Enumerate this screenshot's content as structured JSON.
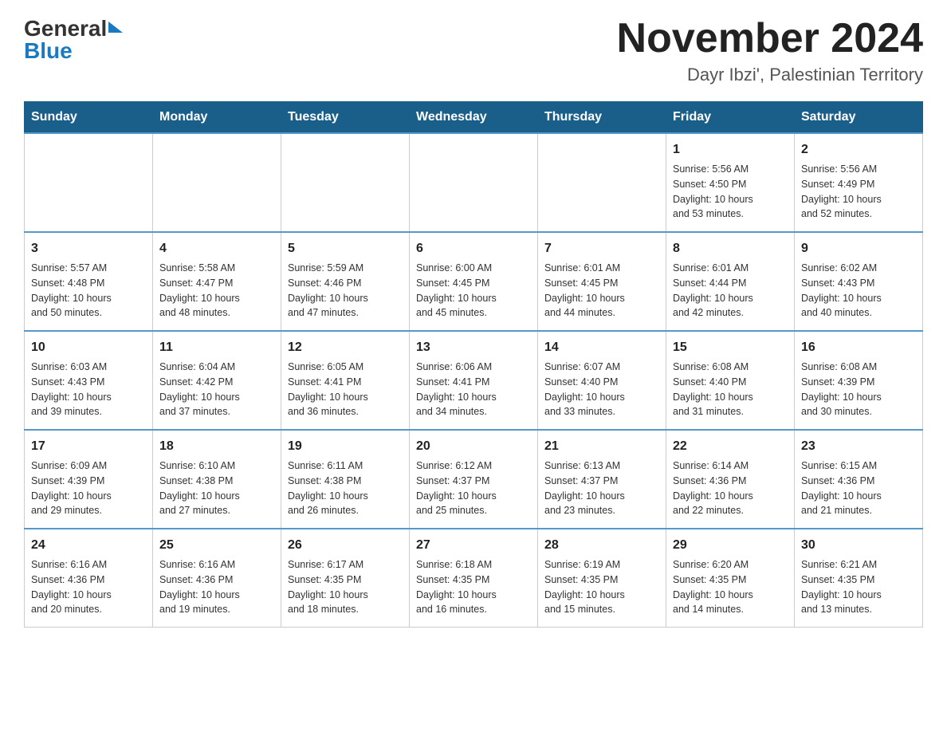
{
  "header": {
    "month_year": "November 2024",
    "location": "Dayr Ibzi', Palestinian Territory",
    "logo_part1": "General",
    "logo_part2": "Blue"
  },
  "weekdays": [
    "Sunday",
    "Monday",
    "Tuesday",
    "Wednesday",
    "Thursday",
    "Friday",
    "Saturday"
  ],
  "weeks": [
    [
      {
        "day": "",
        "info": ""
      },
      {
        "day": "",
        "info": ""
      },
      {
        "day": "",
        "info": ""
      },
      {
        "day": "",
        "info": ""
      },
      {
        "day": "",
        "info": ""
      },
      {
        "day": "1",
        "info": "Sunrise: 5:56 AM\nSunset: 4:50 PM\nDaylight: 10 hours\nand 53 minutes."
      },
      {
        "day": "2",
        "info": "Sunrise: 5:56 AM\nSunset: 4:49 PM\nDaylight: 10 hours\nand 52 minutes."
      }
    ],
    [
      {
        "day": "3",
        "info": "Sunrise: 5:57 AM\nSunset: 4:48 PM\nDaylight: 10 hours\nand 50 minutes."
      },
      {
        "day": "4",
        "info": "Sunrise: 5:58 AM\nSunset: 4:47 PM\nDaylight: 10 hours\nand 48 minutes."
      },
      {
        "day": "5",
        "info": "Sunrise: 5:59 AM\nSunset: 4:46 PM\nDaylight: 10 hours\nand 47 minutes."
      },
      {
        "day": "6",
        "info": "Sunrise: 6:00 AM\nSunset: 4:45 PM\nDaylight: 10 hours\nand 45 minutes."
      },
      {
        "day": "7",
        "info": "Sunrise: 6:01 AM\nSunset: 4:45 PM\nDaylight: 10 hours\nand 44 minutes."
      },
      {
        "day": "8",
        "info": "Sunrise: 6:01 AM\nSunset: 4:44 PM\nDaylight: 10 hours\nand 42 minutes."
      },
      {
        "day": "9",
        "info": "Sunrise: 6:02 AM\nSunset: 4:43 PM\nDaylight: 10 hours\nand 40 minutes."
      }
    ],
    [
      {
        "day": "10",
        "info": "Sunrise: 6:03 AM\nSunset: 4:43 PM\nDaylight: 10 hours\nand 39 minutes."
      },
      {
        "day": "11",
        "info": "Sunrise: 6:04 AM\nSunset: 4:42 PM\nDaylight: 10 hours\nand 37 minutes."
      },
      {
        "day": "12",
        "info": "Sunrise: 6:05 AM\nSunset: 4:41 PM\nDaylight: 10 hours\nand 36 minutes."
      },
      {
        "day": "13",
        "info": "Sunrise: 6:06 AM\nSunset: 4:41 PM\nDaylight: 10 hours\nand 34 minutes."
      },
      {
        "day": "14",
        "info": "Sunrise: 6:07 AM\nSunset: 4:40 PM\nDaylight: 10 hours\nand 33 minutes."
      },
      {
        "day": "15",
        "info": "Sunrise: 6:08 AM\nSunset: 4:40 PM\nDaylight: 10 hours\nand 31 minutes."
      },
      {
        "day": "16",
        "info": "Sunrise: 6:08 AM\nSunset: 4:39 PM\nDaylight: 10 hours\nand 30 minutes."
      }
    ],
    [
      {
        "day": "17",
        "info": "Sunrise: 6:09 AM\nSunset: 4:39 PM\nDaylight: 10 hours\nand 29 minutes."
      },
      {
        "day": "18",
        "info": "Sunrise: 6:10 AM\nSunset: 4:38 PM\nDaylight: 10 hours\nand 27 minutes."
      },
      {
        "day": "19",
        "info": "Sunrise: 6:11 AM\nSunset: 4:38 PM\nDaylight: 10 hours\nand 26 minutes."
      },
      {
        "day": "20",
        "info": "Sunrise: 6:12 AM\nSunset: 4:37 PM\nDaylight: 10 hours\nand 25 minutes."
      },
      {
        "day": "21",
        "info": "Sunrise: 6:13 AM\nSunset: 4:37 PM\nDaylight: 10 hours\nand 23 minutes."
      },
      {
        "day": "22",
        "info": "Sunrise: 6:14 AM\nSunset: 4:36 PM\nDaylight: 10 hours\nand 22 minutes."
      },
      {
        "day": "23",
        "info": "Sunrise: 6:15 AM\nSunset: 4:36 PM\nDaylight: 10 hours\nand 21 minutes."
      }
    ],
    [
      {
        "day": "24",
        "info": "Sunrise: 6:16 AM\nSunset: 4:36 PM\nDaylight: 10 hours\nand 20 minutes."
      },
      {
        "day": "25",
        "info": "Sunrise: 6:16 AM\nSunset: 4:36 PM\nDaylight: 10 hours\nand 19 minutes."
      },
      {
        "day": "26",
        "info": "Sunrise: 6:17 AM\nSunset: 4:35 PM\nDaylight: 10 hours\nand 18 minutes."
      },
      {
        "day": "27",
        "info": "Sunrise: 6:18 AM\nSunset: 4:35 PM\nDaylight: 10 hours\nand 16 minutes."
      },
      {
        "day": "28",
        "info": "Sunrise: 6:19 AM\nSunset: 4:35 PM\nDaylight: 10 hours\nand 15 minutes."
      },
      {
        "day": "29",
        "info": "Sunrise: 6:20 AM\nSunset: 4:35 PM\nDaylight: 10 hours\nand 14 minutes."
      },
      {
        "day": "30",
        "info": "Sunrise: 6:21 AM\nSunset: 4:35 PM\nDaylight: 10 hours\nand 13 minutes."
      }
    ]
  ]
}
